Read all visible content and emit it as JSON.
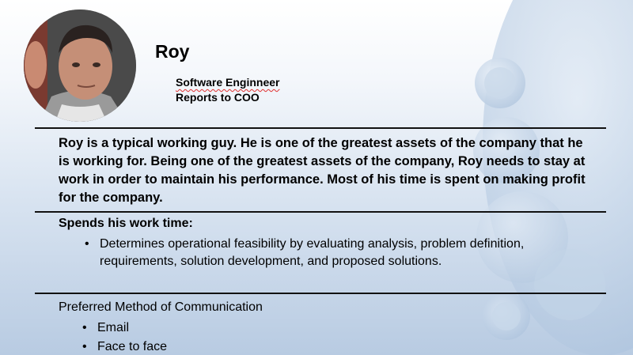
{
  "profile": {
    "name": "Roy",
    "title": "Software Enginneer",
    "reports_to": "Reports to COO"
  },
  "bio": " Roy is a typical working guy. He is one of the greatest assets of the company that he is working for. Being one of the greatest assets of the company, Roy needs to stay at work in order to maintain his performance. Most of his time is spent on making profit for the company.",
  "work_time": {
    "heading": "Spends his work time:",
    "items": [
      "Determines operational feasibility by evaluating analysis, problem definition, requirements, solution development, and proposed solutions."
    ]
  },
  "communication": {
    "heading": "Preferred Method of Communication",
    "items": [
      "Email",
      "Face to face"
    ]
  },
  "colors": {
    "bubble": "#b9cde3",
    "bubble_light": "#dce7f2",
    "rule": "#111111",
    "spellcheck": "#e03030"
  }
}
